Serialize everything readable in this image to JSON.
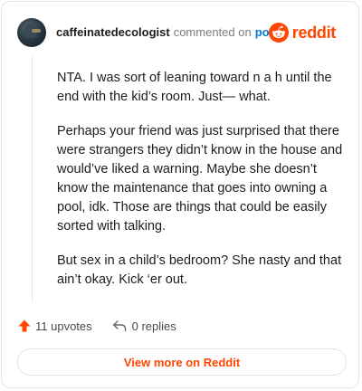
{
  "header": {
    "username": "caffeinatedecologist",
    "action_text": "commented on",
    "post_link": "post",
    "brand_name": "reddit",
    "icons": {
      "avatar": "user-avatar",
      "brand": "reddit-snoo-icon"
    }
  },
  "comment": {
    "paragraphs": [
      "NTA. I was sort of leaning toward n a h until the end with the kid’s room. Just— what.",
      "Perhaps your friend was just surprised that there were strangers they didn’t know in the house and would’ve liked a warning. Maybe she doesn’t know the maintenance that goes into owning a pool, idk. Those are things that could be easily sorted with talking.",
      "But sex in a child’s bedroom? She nasty and that ain’t okay. Kick ‘er out."
    ]
  },
  "actions": {
    "upvotes_label": "11 upvotes",
    "replies_label": "0 replies",
    "icons": {
      "upvote": "upvote-arrow-icon",
      "reply": "reply-arrow-icon"
    }
  },
  "footer": {
    "view_more_label": "View more on Reddit"
  },
  "colors": {
    "brand": "#ff4500",
    "link": "#0079d3",
    "muted": "#7c7c7c",
    "border": "#e3e5e7"
  }
}
